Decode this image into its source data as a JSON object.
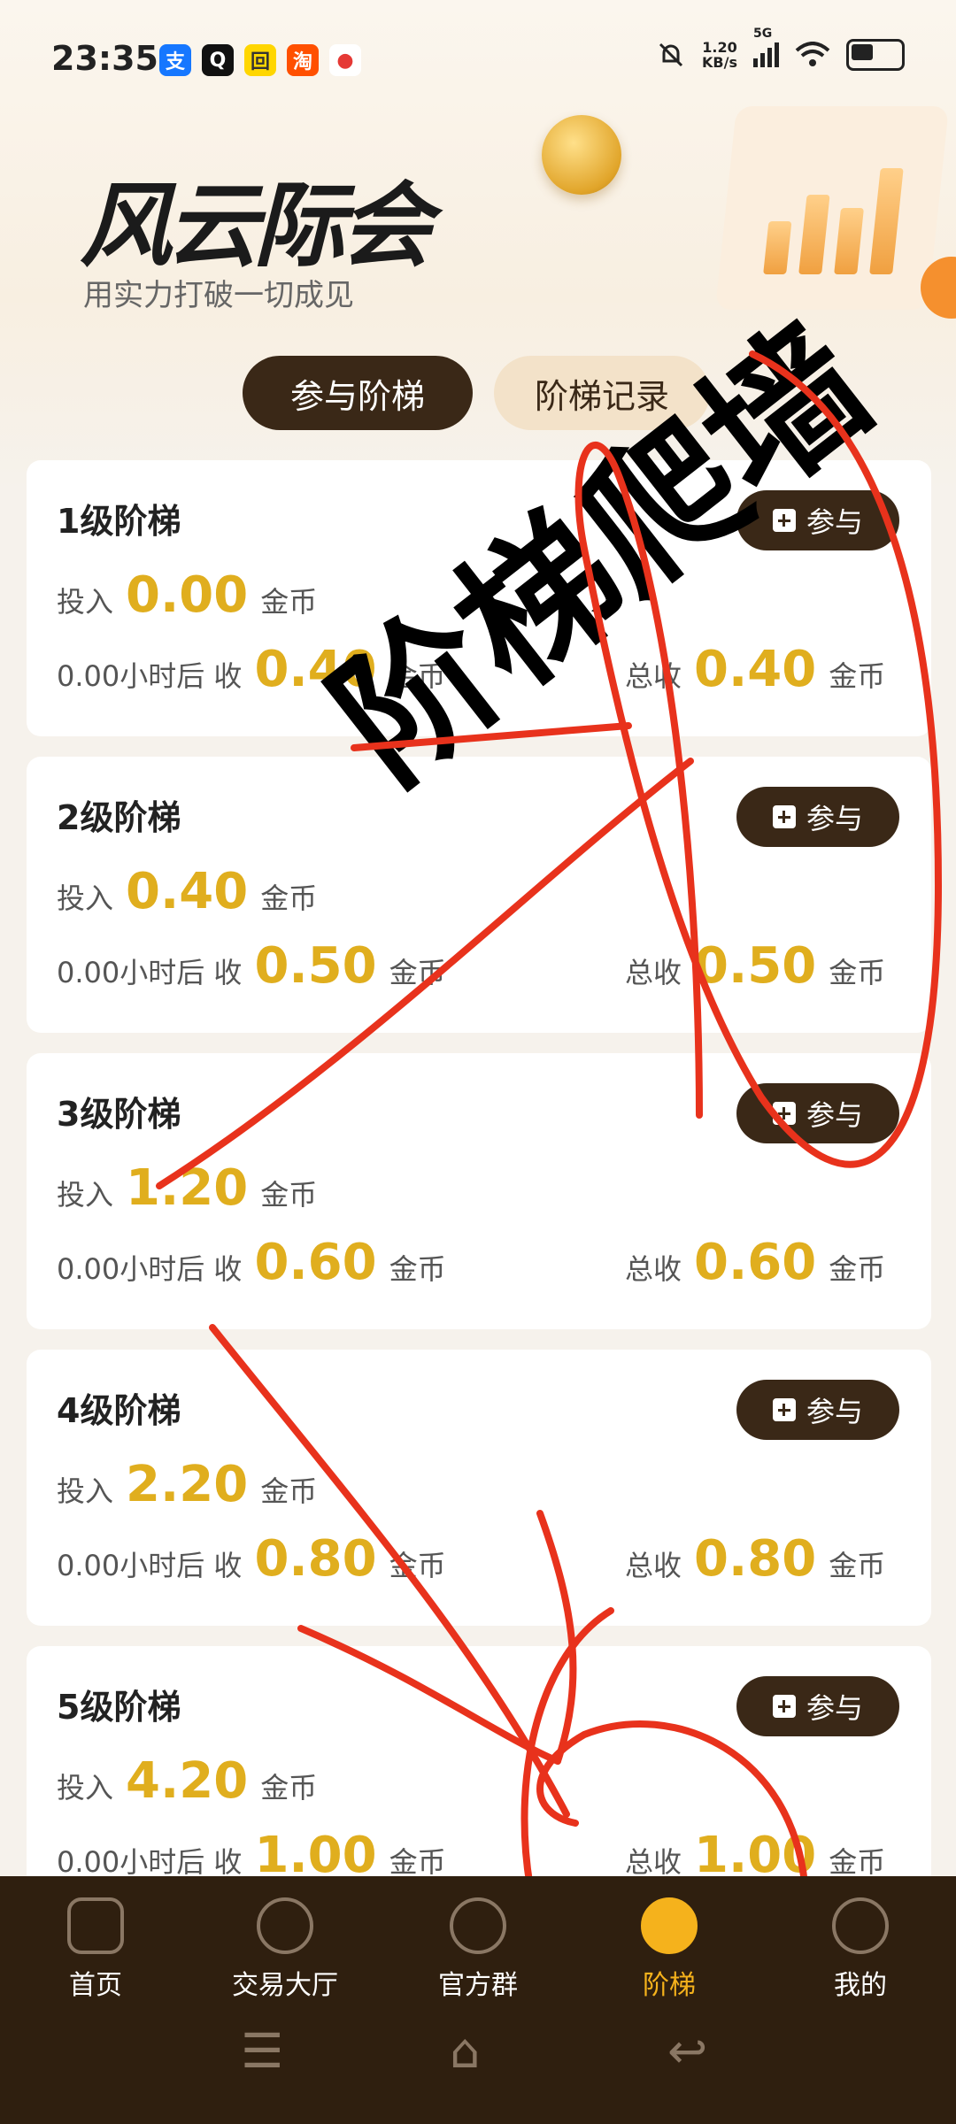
{
  "status_bar": {
    "time": "23:35",
    "apps": [
      {
        "name": "alipay-icon",
        "glyph": "支",
        "color": "#1677ff"
      },
      {
        "name": "qq-icon",
        "glyph": "Q",
        "color": "#111111"
      },
      {
        "name": "app-yellow-icon",
        "glyph": "回",
        "color": "#ffd600"
      },
      {
        "name": "taobao-icon",
        "glyph": "淘",
        "color": "#ff5000"
      },
      {
        "name": "maps-icon",
        "glyph": "●",
        "color": "#e53935"
      }
    ],
    "net_speed_value": "1.20",
    "net_speed_unit": "KB/s",
    "network": "5G"
  },
  "header": {
    "brand": "风云际会",
    "slogan": "用实力打破一切成见"
  },
  "tabs": [
    {
      "label": "参与阶梯",
      "active": true
    },
    {
      "label": "阶梯记录",
      "active": false
    }
  ],
  "labels": {
    "invest": "投入",
    "coin": "金币",
    "receive_prefix": "0.00小时后 收",
    "total": "总收",
    "join": "参与"
  },
  "cards": [
    {
      "title": "1级阶梯",
      "invest": "0.00",
      "receive": "0.40",
      "total": "0.40"
    },
    {
      "title": "2级阶梯",
      "invest": "0.40",
      "receive": "0.50",
      "total": "0.50"
    },
    {
      "title": "3级阶梯",
      "invest": "1.20",
      "receive": "0.60",
      "total": "0.60"
    },
    {
      "title": "4级阶梯",
      "invest": "2.20",
      "receive": "0.80",
      "total": "0.80"
    },
    {
      "title": "5级阶梯",
      "invest": "4.20",
      "receive": "1.00",
      "total": "1.00"
    }
  ],
  "overlay": {
    "text": "阶梯爬墙"
  },
  "bottom_nav": [
    {
      "label": "首页",
      "icon": "home-grid-icon",
      "active": false
    },
    {
      "label": "交易大厅",
      "icon": "trade-hall-icon",
      "active": false
    },
    {
      "label": "官方群",
      "icon": "chat-group-icon",
      "active": false
    },
    {
      "label": "阶梯",
      "icon": "ladder-icon",
      "active": true
    },
    {
      "label": "我的",
      "icon": "profile-icon",
      "active": false
    }
  ],
  "colors": {
    "accent_gold": "#e0ae1e",
    "dark_brown": "#3a2817",
    "nav_active": "#f5b21c",
    "scribble_red": "#e8321c"
  }
}
